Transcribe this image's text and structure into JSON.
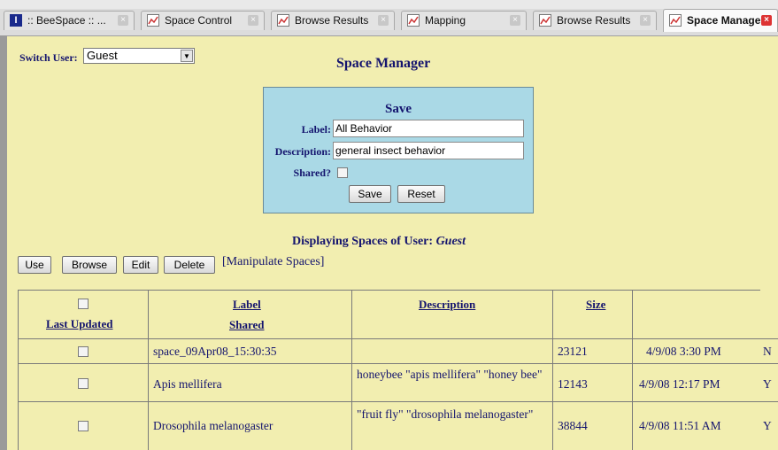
{
  "tabs": [
    {
      "label": ":: BeeSpace :: ...",
      "icon": "beespace-icon",
      "active": false
    },
    {
      "label": "Space Control",
      "icon": "page-icon",
      "active": false
    },
    {
      "label": "Browse Results",
      "icon": "page-icon",
      "active": false
    },
    {
      "label": "Mapping",
      "icon": "page-icon",
      "active": false
    },
    {
      "label": "Browse Results",
      "icon": "page-icon",
      "active": false
    },
    {
      "label": "Space Manager",
      "icon": "page-icon",
      "active": true
    }
  ],
  "switch_user": {
    "label": "Switch User:",
    "value": "Guest"
  },
  "page_title": "Space Manager",
  "save_form": {
    "title": "Save",
    "label_label": "Label:",
    "label_value": "All Behavior",
    "description_label": "Description:",
    "description_value": "general insect behavior",
    "shared_label": "Shared?",
    "save_button": "Save",
    "reset_button": "Reset"
  },
  "displaying": {
    "prefix": "Displaying Spaces of User:",
    "user": "Guest"
  },
  "actions": {
    "use": "Use",
    "browse": "Browse",
    "edit": "Edit",
    "delete": "Delete",
    "manipulate": "[Manipulate Spaces]"
  },
  "table": {
    "headers": {
      "last_updated": "Last Updated",
      "label": "Label",
      "shared": "Shared",
      "description": "Description",
      "size": "Size"
    },
    "rows": [
      {
        "label": "space_09Apr08_15:30:35",
        "description": "",
        "size": "23121",
        "updated": "4/9/08 3:30 PM",
        "shared": "N"
      },
      {
        "label": "Apis mellifera",
        "description": "honeybee \"apis mellifera\" \"honey bee\"",
        "size": "12143",
        "updated": "4/9/08 12:17 PM",
        "shared": "Y"
      },
      {
        "label": "Drosophila melanogaster",
        "description": "\"fruit fly\" \"drosophila melanogaster\"",
        "size": "38844",
        "updated": "4/9/08 11:51 AM",
        "shared": "Y"
      }
    ]
  }
}
